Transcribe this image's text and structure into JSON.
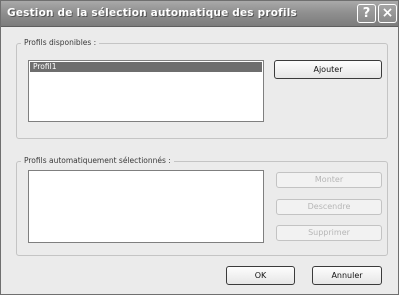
{
  "window": {
    "title": "Gestion de la sélection automatique des profils",
    "help_button": "?",
    "close_button": "×"
  },
  "available_profiles": {
    "label": "Profils disponibles :",
    "items": [
      "Profil1"
    ],
    "add_button": "Ajouter"
  },
  "auto_selected_profiles": {
    "label": "Profils automatiquement sélectionnés :",
    "items": [],
    "up_button": "Monter",
    "down_button": "Descendre",
    "delete_button": "Supprimer"
  },
  "footer": {
    "ok_button": "OK",
    "cancel_button": "Annuler"
  }
}
